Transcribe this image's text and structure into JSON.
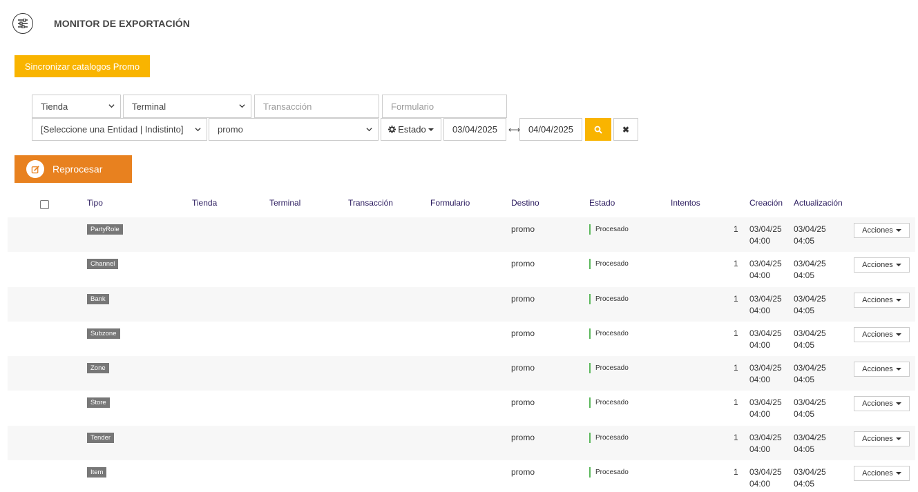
{
  "header": {
    "title": "MONITOR DE EXPORTACIÓN"
  },
  "toolbar": {
    "sync_label": "Sincronizar catalogos Promo",
    "reprocess_label": "Reprocesar"
  },
  "filters": {
    "tienda": "Tienda",
    "terminal": "Terminal",
    "transaccion_placeholder": "Transacción",
    "formulario_placeholder": "Formulario",
    "entidad": "[Seleccione una Entidad | Indistinto]",
    "destino": "promo",
    "estado_label": "Estado",
    "date_from": "03/04/2025",
    "date_to": "04/04/2025"
  },
  "table": {
    "headers": {
      "tipo": "Tipo",
      "tienda": "Tienda",
      "terminal": "Terminal",
      "transaccion": "Transacción",
      "formulario": "Formulario",
      "destino": "Destino",
      "estado": "Estado",
      "intentos": "Intentos",
      "creacion": "Creación",
      "actualizacion": "Actualización"
    },
    "actions_label": "Acciones",
    "rows": [
      {
        "tipo": "PartyRole",
        "destino": "promo",
        "estado": "Procesado",
        "intentos": "1",
        "creacion_date": "03/04/25",
        "creacion_time": "04:00",
        "actualizacion_date": "03/04/25",
        "actualizacion_time": "04:05"
      },
      {
        "tipo": "Channel",
        "destino": "promo",
        "estado": "Procesado",
        "intentos": "1",
        "creacion_date": "03/04/25",
        "creacion_time": "04:00",
        "actualizacion_date": "03/04/25",
        "actualizacion_time": "04:05"
      },
      {
        "tipo": "Bank",
        "destino": "promo",
        "estado": "Procesado",
        "intentos": "1",
        "creacion_date": "03/04/25",
        "creacion_time": "04:00",
        "actualizacion_date": "03/04/25",
        "actualizacion_time": "04:05"
      },
      {
        "tipo": "Subzone",
        "destino": "promo",
        "estado": "Procesado",
        "intentos": "1",
        "creacion_date": "03/04/25",
        "creacion_time": "04:00",
        "actualizacion_date": "03/04/25",
        "actualizacion_time": "04:05"
      },
      {
        "tipo": "Zone",
        "destino": "promo",
        "estado": "Procesado",
        "intentos": "1",
        "creacion_date": "03/04/25",
        "creacion_time": "04:00",
        "actualizacion_date": "03/04/25",
        "actualizacion_time": "04:05"
      },
      {
        "tipo": "Store",
        "destino": "promo",
        "estado": "Procesado",
        "intentos": "1",
        "creacion_date": "03/04/25",
        "creacion_time": "04:00",
        "actualizacion_date": "03/04/25",
        "actualizacion_time": "04:05"
      },
      {
        "tipo": "Tender",
        "destino": "promo",
        "estado": "Procesado",
        "intentos": "1",
        "creacion_date": "03/04/25",
        "creacion_time": "04:00",
        "actualizacion_date": "03/04/25",
        "actualizacion_time": "04:05"
      },
      {
        "tipo": "Item",
        "destino": "promo",
        "estado": "Procesado",
        "intentos": "1",
        "creacion_date": "03/04/25",
        "creacion_time": "04:00",
        "actualizacion_date": "03/04/25",
        "actualizacion_time": "04:05"
      }
    ]
  },
  "colors": {
    "accent_yellow": "#f9b400",
    "accent_orange": "#e8811f",
    "status_green": "#5cb85c",
    "badge_gray": "#777777"
  }
}
